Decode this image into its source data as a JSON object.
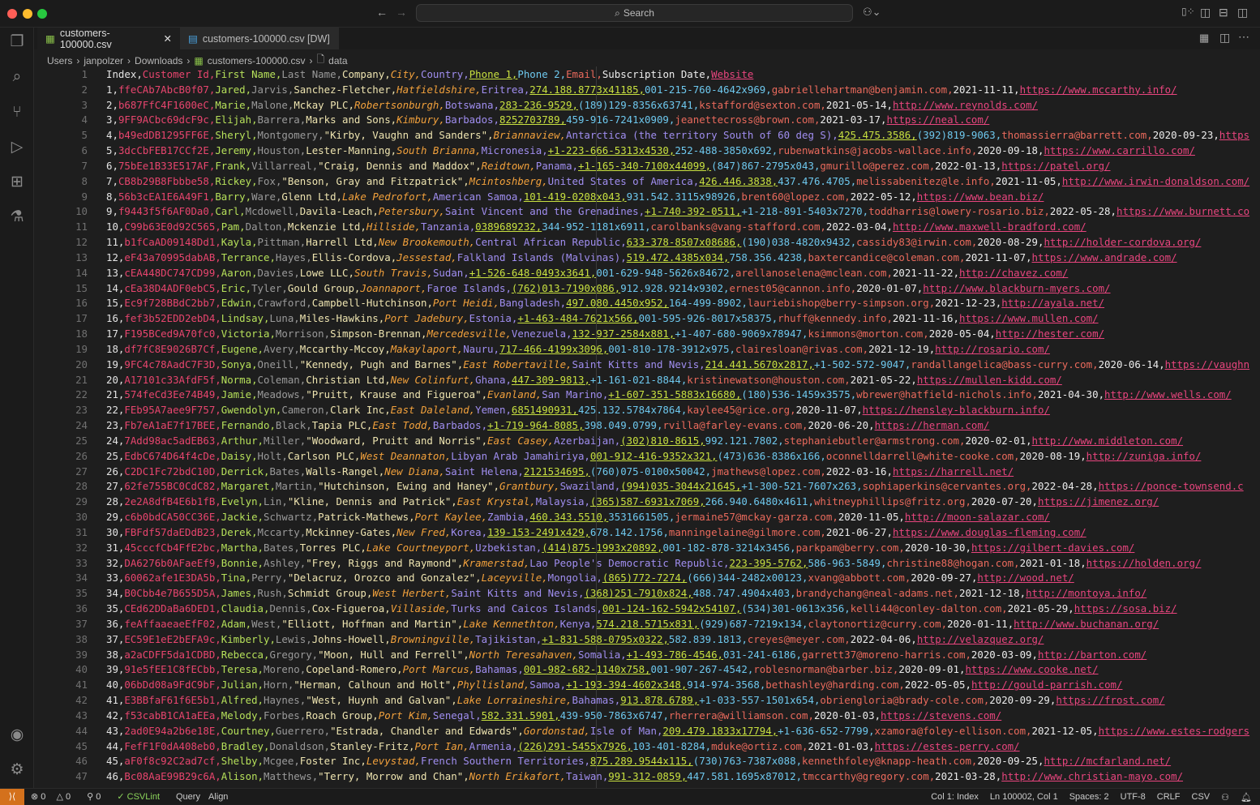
{
  "window": {
    "search_placeholder": "Search",
    "colors": {
      "accent_remote": "#d4711c",
      "close": "#ff5f57",
      "minimize": "#febc2e",
      "maximize": "#28c840"
    }
  },
  "activity_bar": [
    "explorer-icon",
    "search-icon",
    "source-control-icon",
    "run-debug-icon",
    "extensions-icon",
    "testing-icon",
    "accounts-icon",
    "settings-gear-icon"
  ],
  "tabs": [
    {
      "label": "customers-100000.csv",
      "active": true
    },
    {
      "label": "customers-100000.csv [DW]",
      "active": false
    }
  ],
  "breadcrumb": [
    "Users",
    "janpolzer",
    "Downloads",
    "customers-100000.csv",
    "data"
  ],
  "column_colors": [
    "#e4e4e4",
    "#e8456e",
    "#b6e05a",
    "#9a9a9a",
    "#eee4b0",
    "#f2a13c",
    "#a08ef0",
    "#c8e040",
    "#6ec8ee",
    "#ea6a5c",
    "#ececec",
    "#e8457e"
  ],
  "rows": [
    [
      "Index",
      "Customer Id",
      "First Name",
      "Last Name",
      "Company",
      "City",
      "Country",
      "Phone 1",
      "Phone 2",
      "Email",
      "Subscription Date",
      "Website"
    ],
    [
      "1",
      "ffeCAb7AbcB0f07",
      "Jared",
      "Jarvis",
      "Sanchez-Fletcher",
      "Hatfieldshire",
      "Eritrea",
      "274.188.8773x41185",
      "001-215-760-4642x969",
      "gabriellehartman@benjamin.com",
      "2021-11-11",
      "https://www.mccarthy.info/"
    ],
    [
      "2",
      "b687FfC4F1600eC",
      "Marie",
      "Malone",
      "Mckay PLC",
      "Robertsonburgh",
      "Botswana",
      "283-236-9529",
      "(189)129-8356x63741",
      "kstafford@sexton.com",
      "2021-05-14",
      "http://www.reynolds.com/"
    ],
    [
      "3",
      "9FF9ACbc69dcF9c",
      "Elijah",
      "Barrera",
      "Marks and Sons",
      "Kimbury",
      "Barbados",
      "8252703789",
      "459-916-7241x0909",
      "jeanettecross@brown.com",
      "2021-03-17",
      "https://neal.com/"
    ],
    [
      "4",
      "b49edDB1295FF6E",
      "Sheryl",
      "Montgomery",
      "\"Kirby, Vaughn and Sanders\"",
      "Briannaview",
      "Antarctica (the territory South of 60 deg S)",
      "425.475.3586",
      "(392)819-9063",
      "thomassierra@barrett.com",
      "2020-09-23",
      "https"
    ],
    [
      "5",
      "3dcCbFEB17CCf2E",
      "Jeremy",
      "Houston",
      "Lester-Manning",
      "South Brianna",
      "Micronesia",
      "+1-223-666-5313x4530",
      "252-488-3850x692",
      "rubenwatkins@jacobs-wallace.info",
      "2020-09-18",
      "https://www.carrillo.com/"
    ],
    [
      "6",
      "75bEe1B33E517AF",
      "Frank",
      "Villarreal",
      "\"Craig, Dennis and Maddox\"",
      "Reidtown",
      "Panama",
      "+1-165-340-7100x44099",
      "(847)867-2795x043",
      "gmurillo@perez.com",
      "2022-01-13",
      "https://patel.org/"
    ],
    [
      "7",
      "CB8b29B8Fbbbe58",
      "Rickey",
      "Fox",
      "\"Benson, Gray and Fitzpatrick\"",
      "Mcintoshberg",
      "United States of America",
      "426.446.3838",
      "437.476.4705",
      "melissabenitez@le.info",
      "2021-11-05",
      "http://www.irwin-donaldson.com/"
    ],
    [
      "8",
      "56b3cEA1E6A49F1",
      "Barry",
      "Ware",
      "Glenn Ltd",
      "Lake Pedrofort",
      "American Samoa",
      "101-419-0208x043",
      "931.542.3115x98926",
      "brent60@lopez.com",
      "2022-05-12",
      "https://www.bean.biz/"
    ],
    [
      "9",
      "f9443f5f6AF0Da0",
      "Carl",
      "Mcdowell",
      "Davila-Leach",
      "Petersbury",
      "Saint Vincent and the Grenadines",
      "+1-740-392-0511",
      "+1-218-891-5403x7270",
      "toddharris@lowery-rosario.biz",
      "2022-05-28",
      "https://www.burnett.co"
    ],
    [
      "10",
      "C99b63E0d92C565",
      "Pam",
      "Dalton",
      "Mckenzie Ltd",
      "Hillside",
      "Tanzania",
      "0389689232",
      "344-952-1181x6911",
      "carolbanks@vang-stafford.com",
      "2022-03-04",
      "http://www.maxwell-bradford.com/"
    ],
    [
      "11",
      "b1fCaAD09148Dd1",
      "Kayla",
      "Pittman",
      "Harrell Ltd",
      "New Brookemouth",
      "Central African Republic",
      "633-378-8507x08686",
      "(190)038-4820x9432",
      "cassidy83@irwin.com",
      "2020-08-29",
      "http://holder-cordova.org/"
    ],
    [
      "12",
      "eF43a70995dabAB",
      "Terrance",
      "Hayes",
      "Ellis-Cordova",
      "Jessestad",
      "Falkland Islands (Malvinas)",
      "519.472.4385x034",
      "758.356.4238",
      "baxtercandice@coleman.com",
      "2021-11-07",
      "https://www.andrade.com/"
    ],
    [
      "13",
      "cEA448DC747CD99",
      "Aaron",
      "Davies",
      "Lowe LLC",
      "South Travis",
      "Sudan",
      "+1-526-648-0493x3641",
      "001-629-948-5626x84672",
      "arellanoselena@mclean.com",
      "2021-11-22",
      "http://chavez.com/"
    ],
    [
      "14",
      "cEa38D4ADF0ebC5",
      "Eric",
      "Tyler",
      "Gould Group",
      "Joannaport",
      "Faroe Islands",
      "(762)013-7190x086",
      "912.928.9214x9302",
      "ernest05@cannon.info",
      "2020-01-07",
      "http://www.blackburn-myers.com/"
    ],
    [
      "15",
      "Ec9f728BBdC2bb7",
      "Edwin",
      "Crawford",
      "Campbell-Hutchinson",
      "Port Heidi",
      "Bangladesh",
      "497.080.4450x952",
      "164-499-8902",
      "lauriebishop@berry-simpson.org",
      "2021-12-23",
      "http://ayala.net/"
    ],
    [
      "16",
      "fef3b52EDD2ebD4",
      "Lindsay",
      "Luna",
      "Miles-Hawkins",
      "Port Jadebury",
      "Estonia",
      "+1-463-484-7621x566",
      "001-595-926-8017x58375",
      "rhuff@kennedy.info",
      "2021-11-16",
      "https://www.mullen.com/"
    ],
    [
      "17",
      "F195BCed9A70fc0",
      "Victoria",
      "Morrison",
      "Simpson-Brennan",
      "Mercedesville",
      "Venezuela",
      "132-937-2584x881",
      "+1-407-680-9069x78947",
      "ksimmons@morton.com",
      "2020-05-04",
      "http://hester.com/"
    ],
    [
      "18",
      "df7fC8E9026B7Cf",
      "Eugene",
      "Avery",
      "Mccarthy-Mccoy",
      "Makaylaport",
      "Nauru",
      "717-466-4199x3096",
      "001-810-178-3912x975",
      "clairesloan@rivas.com",
      "2021-12-19",
      "http://rosario.com/"
    ],
    [
      "19",
      "9FC4c78AadC7F3D",
      "Sonya",
      "Oneill",
      "\"Kennedy, Pugh and Barnes\"",
      "East Robertaville",
      "Saint Kitts and Nevis",
      "214.441.5670x2817",
      "+1-502-572-9047",
      "randallangelica@bass-curry.com",
      "2020-06-14",
      "https://vaughn"
    ],
    [
      "20",
      "A17101c33AfdF5f",
      "Norma",
      "Coleman",
      "Christian Ltd",
      "New Colinfurt",
      "Ghana",
      "447-309-9813",
      "+1-161-021-8844",
      "kristinewatson@houston.com",
      "2021-05-22",
      "https://mullen-kidd.com/"
    ],
    [
      "21",
      "574feCd3Ee74B49",
      "Jamie",
      "Meadows",
      "\"Pruitt, Krause and Figueroa\"",
      "Evanland",
      "San Marino",
      "+1-607-351-5883x16680",
      "(180)536-1459x3575",
      "wbrewer@hatfield-nichols.info",
      "2021-04-30",
      "http://www.wells.com/"
    ],
    [
      "22",
      "FEb95A7aee9F757",
      "Gwendolyn",
      "Cameron",
      "Clark Inc",
      "East Daleland",
      "Yemen",
      "6851490931",
      "425.132.5784x7864",
      "kaylee45@rice.org",
      "2020-11-07",
      "https://hensley-blackburn.info/"
    ],
    [
      "23",
      "Fb7eA1aE7f17BEE",
      "Fernando",
      "Black",
      "Tapia PLC",
      "East Todd",
      "Barbados",
      "+1-719-964-8085",
      "398.049.0799",
      "rvilla@farley-evans.com",
      "2020-06-20",
      "https://herman.com/"
    ],
    [
      "24",
      "7Add98ac5adEB63",
      "Arthur",
      "Miller",
      "\"Woodward, Pruitt and Norris\"",
      "East Casey",
      "Azerbaijan",
      "(302)810-8615",
      "992.121.7802",
      "stephaniebutler@armstrong.com",
      "2020-02-01",
      "http://www.middleton.com/"
    ],
    [
      "25",
      "EdbC674D64f4cDe",
      "Daisy",
      "Holt",
      "Carlson PLC",
      "West Deannaton",
      "Libyan Arab Jamahiriya",
      "001-912-416-9352x321",
      "(473)636-8386x166",
      "oconnelldarrell@white-cooke.com",
      "2020-08-19",
      "http://zuniga.info/"
    ],
    [
      "26",
      "C2DC1Fc72bdC10D",
      "Derrick",
      "Bates",
      "Walls-Rangel",
      "New Diana",
      "Saint Helena",
      "2121534695",
      "(760)075-0100x50042",
      "jmathews@lopez.com",
      "2022-03-16",
      "https://harrell.net/"
    ],
    [
      "27",
      "62fe755BC0CdC82",
      "Margaret",
      "Martin",
      "\"Hutchinson, Ewing and Haney\"",
      "Grantbury",
      "Swaziland",
      "(994)035-3044x21645",
      "+1-300-521-7607x263",
      "sophiaperkins@cervantes.org",
      "2022-04-28",
      "https://ponce-townsend.c"
    ],
    [
      "28",
      "2e2A8dfB4E6b1fB",
      "Evelyn",
      "Lin",
      "\"Kline, Dennis and Patrick\"",
      "East Krystal",
      "Malaysia",
      "(365)587-6931x7069",
      "266.940.6480x4611",
      "whitneyphillips@fritz.org",
      "2020-07-20",
      "https://jimenez.org/"
    ],
    [
      "29",
      "c6b0bdCA50CC36E",
      "Jackie",
      "Schwartz",
      "Patrick-Mathews",
      "Port Kaylee",
      "Zambia",
      "460.343.5510",
      "3531661505",
      "jermaine57@mckay-garza.com",
      "2020-11-05",
      "http://moon-salazar.com/"
    ],
    [
      "30",
      "FBFdf57daEDdB23",
      "Derek",
      "Mccarty",
      "Mckinney-Gates",
      "New Fred",
      "Korea",
      "139-153-2491x429",
      "678.142.1756",
      "manningelaine@gilmore.com",
      "2021-06-27",
      "https://www.douglas-fleming.com/"
    ],
    [
      "31",
      "45cccfCb4FfE2bc",
      "Martha",
      "Bates",
      "Torres PLC",
      "Lake Courtneyport",
      "Uzbekistan",
      "(414)875-1993x20892",
      "001-182-878-3214x3456",
      "parkpam@berry.com",
      "2020-10-30",
      "https://gilbert-davies.com/"
    ],
    [
      "32",
      "DA6276b0AFaeEf9",
      "Bonnie",
      "Ashley",
      "\"Frey, Riggs and Raymond\"",
      "Kramerstad",
      "Lao People's Democratic Republic",
      "223-395-5762",
      "586-963-5849",
      "christine88@hogan.com",
      "2021-01-18",
      "https://holden.org/"
    ],
    [
      "33",
      "60062afe1E3DA5b",
      "Tina",
      "Perry",
      "\"Delacruz, Orozco and Gonzalez\"",
      "Laceyville",
      "Mongolia",
      "(865)772-7274",
      "(666)344-2482x00123",
      "xvang@abbott.com",
      "2020-09-27",
      "http://wood.net/"
    ],
    [
      "34",
      "B0Cbb4e7B655D5A",
      "James",
      "Rush",
      "Schmidt Group",
      "West Herbert",
      "Saint Kitts and Nevis",
      "(368)251-7910x824",
      "488.747.4904x403",
      "brandychang@neal-adams.net",
      "2021-12-18",
      "http://montoya.info/"
    ],
    [
      "35",
      "CEd62DDaBa6DED1",
      "Claudia",
      "Dennis",
      "Cox-Figueroa",
      "Villaside",
      "Turks and Caicos Islands",
      "001-124-162-5942x54107",
      "(534)301-0613x356",
      "kelli44@conley-dalton.com",
      "2021-05-29",
      "https://sosa.biz/"
    ],
    [
      "36",
      "feAffaaeaeEfF02",
      "Adam",
      "West",
      "\"Elliott, Hoffman and Martin\"",
      "Lake Kennethton",
      "Kenya",
      "574.218.5715x831",
      "(929)687-7219x134",
      "claytonortiz@curry.com",
      "2020-01-11",
      "http://www.buchanan.org/"
    ],
    [
      "37",
      "EC59E1eE2bEFA9c",
      "Kimberly",
      "Lewis",
      "Johns-Howell",
      "Browningville",
      "Tajikistan",
      "+1-831-588-0795x0322",
      "582.839.1813",
      "creyes@meyer.com",
      "2022-04-06",
      "http://velazquez.org/"
    ],
    [
      "38",
      "a2aCDFF5da1CDBD",
      "Rebecca",
      "Gregory",
      "\"Moon, Hull and Ferrell\"",
      "North Teresahaven",
      "Somalia",
      "+1-493-786-4546",
      "031-241-6186",
      "garrett37@moreno-harris.com",
      "2020-03-09",
      "http://barton.com/"
    ],
    [
      "39",
      "91e5fEE1C8fECbb",
      "Teresa",
      "Moreno",
      "Copeland-Romero",
      "Port Marcus",
      "Bahamas",
      "001-982-682-1140x758",
      "001-907-267-4542",
      "roblesnorman@barber.biz",
      "2020-09-01",
      "https://www.cooke.net/"
    ],
    [
      "40",
      "06bDd08a9FdC9bF",
      "Julian",
      "Horn",
      "\"Herman, Calhoun and Holt\"",
      "Phyllisland",
      "Samoa",
      "+1-193-394-4602x348",
      "914-974-3568",
      "bethashley@harding.com",
      "2022-05-05",
      "http://gould-parrish.com/"
    ],
    [
      "41",
      "E3BBfaF61f6E5b1",
      "Alfred",
      "Haynes",
      "\"West, Huynh and Galvan\"",
      "Lake Lorraineshire",
      "Bahamas",
      "913.878.6789",
      "+1-033-557-1501x654",
      "obriengloria@brady-cole.com",
      "2020-09-29",
      "https://frost.com/"
    ],
    [
      "42",
      "f53cabB1CA1aEEa",
      "Melody",
      "Forbes",
      "Roach Group",
      "Port Kim",
      "Senegal",
      "582.331.5901",
      "439-950-7863x6747",
      "rherrera@williamson.com",
      "2020-01-03",
      "https://stevens.com/"
    ],
    [
      "43",
      "2ad0E94a2b6e18E",
      "Courtney",
      "Guerrero",
      "\"Estrada, Chandler and Edwards\"",
      "Gordonstad",
      "Isle of Man",
      "209.479.1833x17794",
      "+1-636-652-7799",
      "xzamora@foley-ellison.com",
      "2021-12-05",
      "https://www.estes-rodgers"
    ],
    [
      "44",
      "FefF1F0dA408eb0",
      "Bradley",
      "Donaldson",
      "Stanley-Fritz",
      "Port Ian",
      "Armenia",
      "(226)291-5455x7926",
      "103-401-8284",
      "mduke@ortiz.com",
      "2021-01-03",
      "https://estes-perry.com/"
    ],
    [
      "45",
      "aF0f8c92C2ad7cf",
      "Shelby",
      "Mcgee",
      "Foster Inc",
      "Levystad",
      "French Southern Territories",
      "875.289.9544x115",
      "(730)763-7387x088",
      "kennethfoley@knapp-heath.com",
      "2020-09-25",
      "http://mcfarland.net/"
    ],
    [
      "46",
      "Bc08AaE99B29c6A",
      "Alison",
      "Matthews",
      "\"Terry, Morrow and Chan\"",
      "North Erikafort",
      "Taiwan",
      "991-312-0859",
      "447.581.1695x87012",
      "tmccarthy@gregory.com",
      "2021-03-28",
      "http://www.christian-mayo.com/"
    ]
  ],
  "status": {
    "errors": "0",
    "warnings": "0",
    "ports": "0",
    "csvlint": "CSVLint",
    "query": "Query",
    "align": "Align",
    "col": "Col 1: Index",
    "position": "Ln 100002, Col 1",
    "spaces": "Spaces: 2",
    "encoding": "UTF-8",
    "eol": "CRLF",
    "language": "CSV"
  }
}
